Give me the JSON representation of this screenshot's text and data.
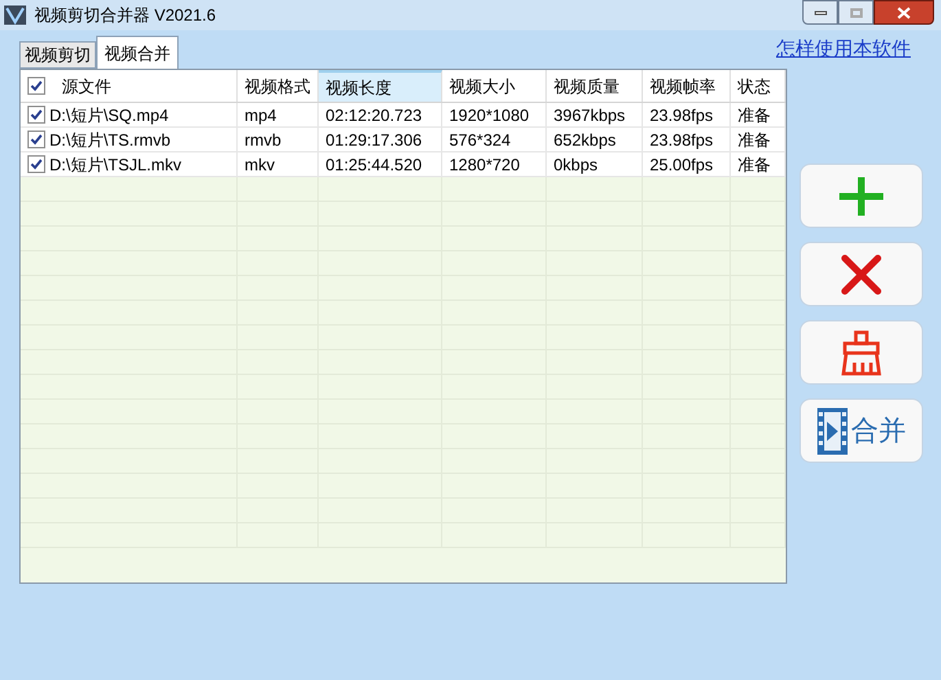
{
  "window": {
    "title": "视频剪切合并器 V2021.6"
  },
  "tabs": [
    {
      "label": "视频剪切",
      "selected": false
    },
    {
      "label": "视频合并",
      "selected": true
    }
  ],
  "help_link": "怎样使用本软件",
  "table": {
    "select_all_checked": true,
    "columns": [
      {
        "label": "源文件",
        "selected": false
      },
      {
        "label": "视频格式",
        "selected": false
      },
      {
        "label": "视频长度",
        "selected": true
      },
      {
        "label": "视频大小",
        "selected": false
      },
      {
        "label": "视频质量",
        "selected": false
      },
      {
        "label": "视频帧率",
        "selected": false
      },
      {
        "label": "状态",
        "selected": false
      }
    ],
    "rows": [
      {
        "checked": true,
        "cells": [
          "D:\\短片\\SQ.mp4",
          "mp4",
          "02:12:20.723",
          "1920*1080",
          "3967kbps",
          "23.98fps",
          "准备"
        ]
      },
      {
        "checked": true,
        "cells": [
          "D:\\短片\\TS.rmvb",
          "rmvb",
          "01:29:17.306",
          "576*324",
          "652kbps",
          "23.98fps",
          "准备"
        ]
      },
      {
        "checked": true,
        "cells": [
          "D:\\短片\\TSJL.mkv",
          "mkv",
          "01:25:44.520",
          "1280*720",
          "0kbps",
          "25.00fps",
          "准备"
        ]
      }
    ]
  },
  "side_buttons": [
    {
      "kind": "add"
    },
    {
      "kind": "delete"
    },
    {
      "kind": "clear"
    },
    {
      "kind": "merge",
      "label": "合并"
    }
  ]
}
